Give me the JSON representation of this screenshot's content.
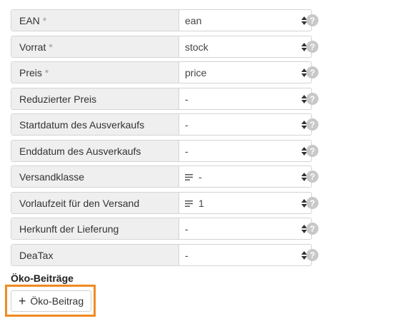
{
  "fields": [
    {
      "label": "EAN",
      "required": true,
      "value": "ean",
      "list_icon": false
    },
    {
      "label": "Vorrat",
      "required": true,
      "value": "stock",
      "list_icon": false
    },
    {
      "label": "Preis",
      "required": true,
      "value": "price",
      "list_icon": false
    },
    {
      "label": "Reduzierter Preis",
      "required": false,
      "value": "-",
      "list_icon": false
    },
    {
      "label": "Startdatum des Ausverkaufs",
      "required": false,
      "value": "-",
      "list_icon": false
    },
    {
      "label": "Enddatum des Ausverkaufs",
      "required": false,
      "value": "-",
      "list_icon": false
    },
    {
      "label": "Versandklasse",
      "required": false,
      "value": "-",
      "list_icon": true
    },
    {
      "label": "Vorlaufzeit für den Versand",
      "required": false,
      "value": "1",
      "list_icon": true
    },
    {
      "label": "Herkunft der Lieferung",
      "required": false,
      "value": "-",
      "list_icon": false
    },
    {
      "label": "DeaTax",
      "required": false,
      "value": "-",
      "list_icon": false
    }
  ],
  "required_marker": "*",
  "help_glyph": "?",
  "eco": {
    "title": "Öko-Beiträge",
    "add_button_label": "Öko-Beitrag",
    "add_icon": "plus-icon",
    "highlight_color": "#f08a23"
  }
}
